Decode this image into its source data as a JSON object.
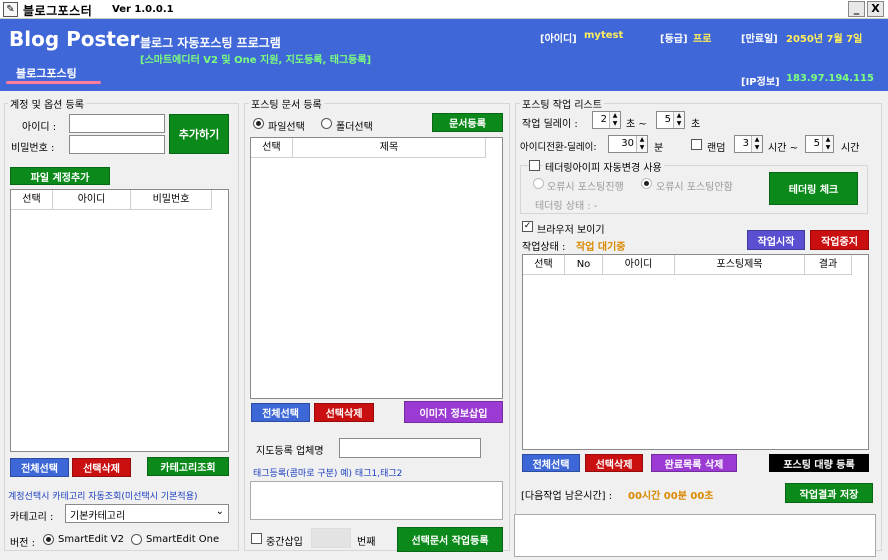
{
  "window": {
    "title": "블로그포스터",
    "version": "Ver 1.0.0.1",
    "minimize": "_",
    "close": "X"
  },
  "header": {
    "logo": "Blog Poster",
    "subtitle": "블로그 자동포스팅 프로그램",
    "subtitle2": "[스마트에디터 V2 및 One 지원, 지도등록, 태그등록]",
    "id_label": "[아이디]",
    "id_value": "mytest",
    "grade_label": "[등급]",
    "grade_value": "프로",
    "expiry_label": "[만료일]",
    "expiry_value": "2050년 7월 7일",
    "ip_label": "[IP정보]",
    "ip_value": "183.97.194.115",
    "nav_tab": "블로그포스팅"
  },
  "account": {
    "group_title": "계정 및 옵션 등록",
    "id_label": "아이디 :",
    "pw_label": "비밀번호 :",
    "id_value": "",
    "pw_value": "",
    "add_button": "추가하기",
    "file_add_button": "파일 계정추가",
    "columns": [
      "선택",
      "아이디",
      "비밀번호"
    ],
    "select_all": "전체선택",
    "delete_selected": "선택삭제",
    "category_lookup": "카테고리조회",
    "auto_category_note": "계정선택시 카테고리 자동조회(미선택시 기본적용)",
    "category_label": "카테고리 :",
    "category_value": "기본카테고리",
    "version_label": "버전 :",
    "version_v2": "SmartEdit V2",
    "version_one": "SmartEdit One"
  },
  "docs": {
    "group_title": "포스팅 문서 등록",
    "file_select": "파일선택",
    "folder_select": "폴더선택",
    "register_button": "문서등록",
    "columns": [
      "선택",
      "제목"
    ],
    "select_all": "전체선택",
    "delete_selected": "선택삭제",
    "image_info_button": "이미지 정보삽입",
    "map_label": "지도등록 업체명",
    "map_value": "",
    "tag_label": "태그등록(콤마로 구분) 예) 태그1,태그2",
    "tag_value": "",
    "middle_insert": "중간삽입",
    "middle_insert_value": "",
    "middle_unit": "번째",
    "register_task_button": "선택문서 작업등록"
  },
  "tasks": {
    "group_title": "포스팅 작업 리스트",
    "delay_label": "작업 딜레이 :",
    "delay_min": "2",
    "delay_tilde": "초 ~",
    "delay_max": "5",
    "delay_unit": "초",
    "switch_label": "아이디전환-딜레이:",
    "switch_value": "30",
    "switch_unit": "분",
    "random_label": "랜덤",
    "random_min": "3",
    "random_mid": "시간 ~",
    "random_max": "5",
    "random_unit": "시간",
    "tethering_check": "테더링아이피 자동변경 사용",
    "on_error_continue": "오류시 포스팅진행",
    "on_error_stop": "오류시 포스팅안함",
    "tethering_status": "테더링 상태 : -",
    "tethering_check_button": "테더링 체크",
    "show_browser": "브라우저 보이기",
    "status_label": "작업상태 :",
    "status_value": "작업 대기중",
    "start_button": "작업시작",
    "stop_button": "작업중지",
    "columns": [
      "선택",
      "No",
      "아이디",
      "포스팅제목",
      "결과"
    ],
    "select_all": "전체선택",
    "delete_selected": "선택삭제",
    "delete_completed": "완료목록 삭제",
    "bulk_register": "포스팅 대량 등록",
    "next_label": "[다음작업 남은시간] :",
    "next_value": "00시간 00분 00초",
    "save_results": "작업결과 저장",
    "log_value": ""
  },
  "colors": {
    "header_bg": "#3f67d8",
    "green": "#0b8a1b",
    "blue": "#3d67d6",
    "red": "#c90f0f",
    "purple": "#9b3bd4",
    "yellow_text": "#ffef5a",
    "green_text": "#7dff7d",
    "status_text": "#d98a00"
  }
}
